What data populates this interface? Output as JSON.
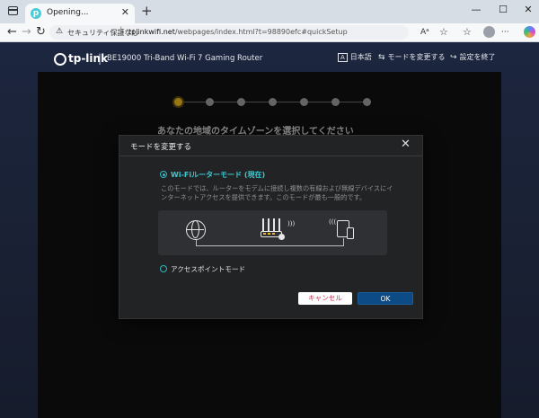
{
  "browser": {
    "tab_title": "Opening...",
    "tab_close": "✕",
    "new_tab": "+",
    "window_controls": {
      "minimize": "—",
      "maximize": "☐",
      "close": "✕"
    },
    "back": "←",
    "forward": "→",
    "reload": "↻",
    "security_icon": "⚠",
    "security_label": "セキュリティ保護なし",
    "url_separator": "|",
    "url_host": "tplinkwifi.net",
    "url_path": "/webpages/index.html?t=98890efc#quickSetup",
    "toolbar_icons": [
      "text-icon",
      "star-icon",
      "favorites-icon",
      "collections-icon",
      "profile-icon",
      "more-icon",
      "copilot-icon"
    ],
    "toolbar_glyphs": {
      "text": "Aᵃ",
      "star": "☆",
      "favorites": "☆",
      "collections": "⧉",
      "more": "···"
    }
  },
  "router_header": {
    "brand": "tp-link",
    "divider": "|",
    "model": "BE19000 Tri-Band Wi-Fi 7 Gaming Router",
    "language_icon": "A",
    "language": "日本語",
    "change_mode_icon": "⇆",
    "change_mode": "モードを変更する",
    "exit_icon": "↪",
    "exit_setup": "設定を終了"
  },
  "wizard": {
    "step_count": 7,
    "active_step": 1,
    "title": "あなたの地域のタイムゾーンを選択してください"
  },
  "modal": {
    "title": "モードを変更する",
    "close": "✕",
    "option_router": {
      "label": "Wi-Fiルーターモード (現在)",
      "selected": true,
      "description": "このモードでは、ルーターをモデムに接続し複数の有線および無線デバイスにインターネットアクセスを提供できます。このモードが最も一般的です。"
    },
    "option_ap": {
      "label": "アクセスポイントモード",
      "selected": false
    },
    "cancel_label": "キャンセル",
    "ok_label": "OK"
  },
  "colors": {
    "accent": "#2fb7c4",
    "active_step": "#e8b61e",
    "ok_button": "#0d4b86",
    "cancel_text": "#c22d4f"
  }
}
